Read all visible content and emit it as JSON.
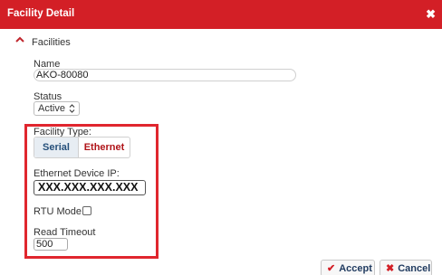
{
  "dialog": {
    "title": "Facility Detail",
    "close_glyph": "✖"
  },
  "section": {
    "label": "Facilities",
    "icon": "caret-up-icon"
  },
  "fields": {
    "name_label": "Name",
    "name_value": "AKO-80080",
    "status_label": "Status",
    "status_value": "Active",
    "facility_type_label": "Facility Type:",
    "facility_type_options": [
      "Serial",
      "Ethernet"
    ],
    "facility_type_selected": "Ethernet",
    "ip_label": "Ethernet Device IP:",
    "ip_value": "XXX.XXX.XXX.XXX",
    "rtu_label": "RTU Mode:",
    "rtu_checked": false,
    "timeout_label": "Read Timeout",
    "timeout_value": "500"
  },
  "buttons": {
    "accept_label": "Accept",
    "accept_icon": "✔",
    "cancel_label": "Cancel",
    "cancel_icon": "✖"
  },
  "colors": {
    "title_bar": "#d31f26",
    "highlight": "#e0262e",
    "serial_text": "#254f7a",
    "ethernet_text": "#b01419"
  }
}
